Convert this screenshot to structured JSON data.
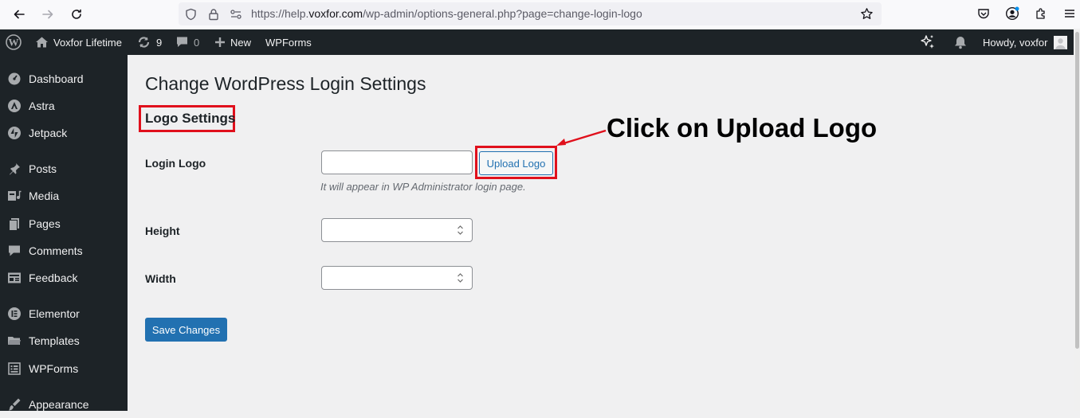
{
  "browser": {
    "url_prefix": "https://help.",
    "url_host": "voxfor.com",
    "url_path": "/wp-admin/options-general.php?page=change-login-logo"
  },
  "adminbar": {
    "site_name": "Voxfor Lifetime",
    "updates_count": "9",
    "comments_count": "0",
    "new_label": "New",
    "wpforms_label": "WPForms",
    "howdy": "Howdy, voxfor"
  },
  "sidebar": {
    "items": [
      {
        "label": "Dashboard",
        "icon": "dashboard-icon"
      },
      {
        "label": "Astra",
        "icon": "astra-icon"
      },
      {
        "label": "Jetpack",
        "icon": "jetpack-icon"
      },
      {
        "label": "Posts",
        "icon": "pin-icon"
      },
      {
        "label": "Media",
        "icon": "media-icon"
      },
      {
        "label": "Pages",
        "icon": "pages-icon"
      },
      {
        "label": "Comments",
        "icon": "comment-icon"
      },
      {
        "label": "Feedback",
        "icon": "feedback-icon"
      },
      {
        "label": "Elementor",
        "icon": "elementor-icon"
      },
      {
        "label": "Templates",
        "icon": "folder-icon"
      },
      {
        "label": "WPForms",
        "icon": "form-icon"
      },
      {
        "label": "Appearance",
        "icon": "brush-icon"
      }
    ]
  },
  "main": {
    "page_title": "Change WordPress Login Settings",
    "section_title": "Logo Settings",
    "login_logo_label": "Login Logo",
    "login_logo_value": "",
    "upload_button": "Upload Logo",
    "hint": "It will appear in WP Administrator login page.",
    "height_label": "Height",
    "height_value": "",
    "width_label": "Width",
    "width_value": "",
    "save_button": "Save Changes"
  },
  "annotation": {
    "text": "Click on Upload Logo",
    "color": "#e0101c"
  },
  "colors": {
    "admin_dark": "#1d2327",
    "wp_blue": "#2271b1",
    "highlight_red": "#e0101c"
  }
}
